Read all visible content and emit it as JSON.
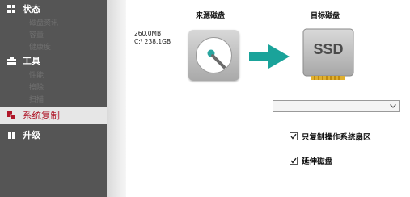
{
  "sidebar": {
    "status": {
      "label": "状态",
      "icon": "grid-icon",
      "items": [
        "磁盘资讯",
        "容量",
        "健康度"
      ]
    },
    "tools": {
      "label": "工具",
      "icon": "toolbox-icon",
      "items": [
        "性能",
        "擦除",
        "扫描"
      ]
    },
    "clone": {
      "label": "系统复制",
      "icon": "clone-icon"
    },
    "upgrade": {
      "label": "升级",
      "icon": "upgrade-icon"
    }
  },
  "main": {
    "source": {
      "label": "来源磁盘",
      "size": "260.0MB",
      "drive": "C:\\  238.1GB",
      "icon": "hard-disk-icon"
    },
    "target": {
      "label": "目标磁盘",
      "icon": "ssd-icon",
      "icon_text": "SSD"
    },
    "arrow_icon": "arrow-right-icon",
    "target_select": {
      "value": ""
    },
    "options": {
      "system_partition_only": {
        "label": "只复制操作系统扇区",
        "checked": true
      },
      "extend_disk": {
        "label": "延伸磁盘",
        "checked": true
      }
    }
  },
  "colors": {
    "sidebar_bg": "#555555",
    "active_item_bg": "#e6e6e6",
    "active_accent": "#b0182a",
    "arrow": "#1aa39a"
  }
}
